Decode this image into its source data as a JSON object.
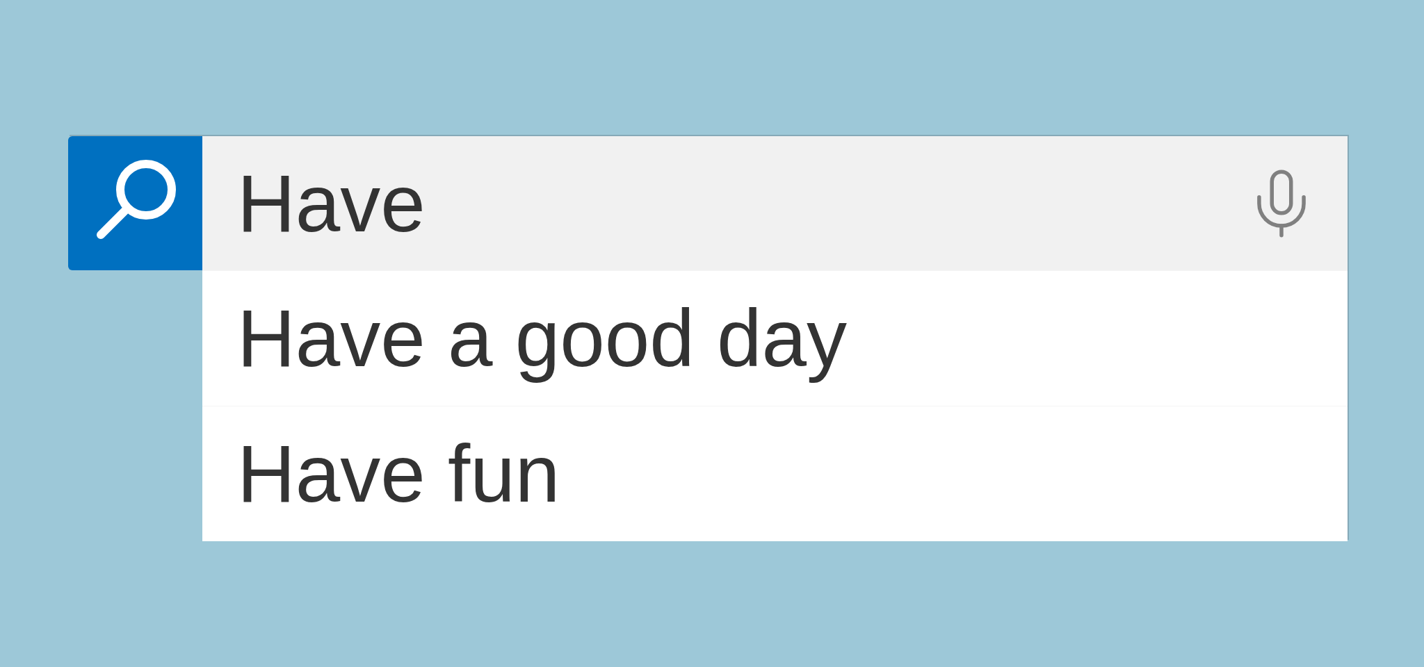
{
  "search": {
    "value": "Have"
  },
  "suggestions": [
    {
      "text": "Have a good day"
    },
    {
      "text": "Have fun"
    }
  ]
}
